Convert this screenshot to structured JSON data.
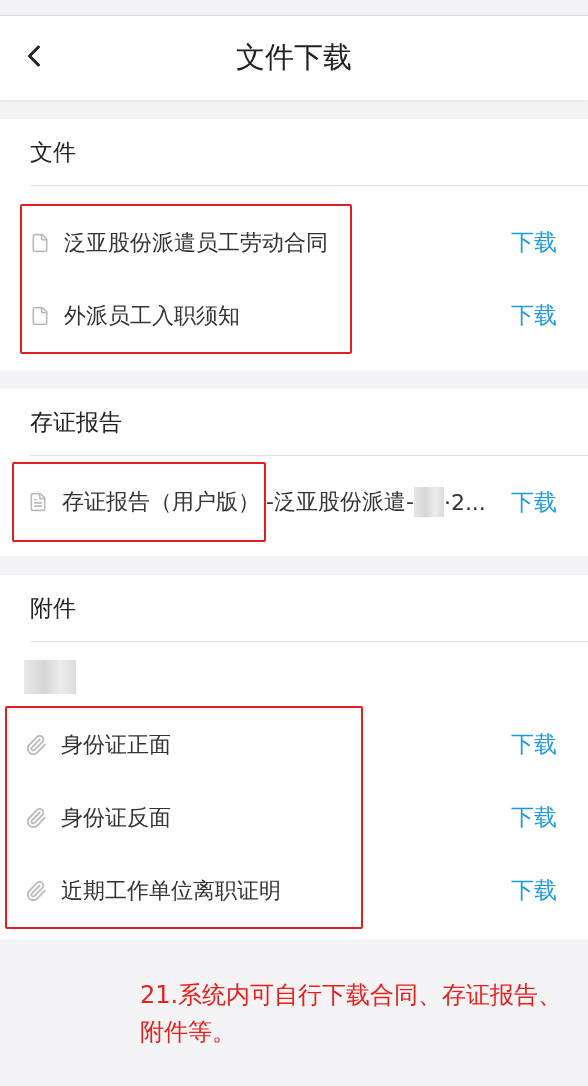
{
  "header": {
    "title": "文件下载"
  },
  "sections": [
    {
      "title": "文件",
      "kind": "files",
      "highlighted": true,
      "items": [
        {
          "name": "泛亚股份派遣员工劳动合同",
          "action": "下载"
        },
        {
          "name": "外派员工入职须知",
          "action": "下载"
        }
      ]
    },
    {
      "title": "存证报告",
      "kind": "report",
      "items": [
        {
          "name": "存证报告（用户版）",
          "name_rest": "-泛亚股份派遣-",
          "name_tail": "·2...",
          "redacted": true,
          "highlighted": true,
          "action": "下载"
        }
      ]
    },
    {
      "title": "附件",
      "kind": "attachments",
      "redacted_caption": true,
      "highlighted": true,
      "items": [
        {
          "name": "身份证正面",
          "action": "下载"
        },
        {
          "name": "身份证反面",
          "action": "下载"
        },
        {
          "name": "近期工作单位离职证明",
          "action": "下载"
        }
      ]
    }
  ],
  "note": "21.系统内可自行下载合同、存证报告、附件等。"
}
